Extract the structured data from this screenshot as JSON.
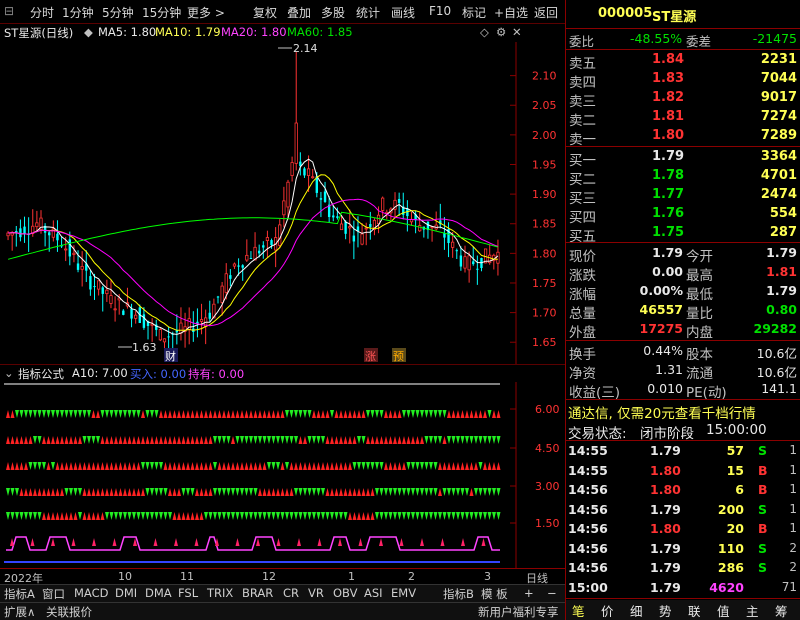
{
  "toolbar": {
    "items": [
      "分时",
      "1分钟",
      "5分钟",
      "15分钟",
      "更多 >",
      "复权",
      "叠加",
      "多股",
      "统计",
      "画线",
      "F10",
      "标记",
      "+自选",
      "返回"
    ]
  },
  "chart": {
    "title": "ST星源(日线)",
    "ma5": "MA5: 1.80",
    "ma10": "MA10: 1.79",
    "ma20": "MA20: 1.80",
    "ma60": "MA60: 1.85",
    "high_label": "2.14",
    "low_label": "1.63",
    "marker_cai": "财",
    "marker_zhang": "涨",
    "marker_yu": "预",
    "y_ticks": [
      "2.10",
      "2.05",
      "2.00",
      "1.95",
      "1.90",
      "1.85",
      "1.80",
      "1.75",
      "1.70",
      "1.65"
    ],
    "colors": {
      "up": "#ff3333",
      "down": "#00ffff",
      "ma5": "#ffffff",
      "ma10": "#ffff00",
      "ma20": "#ff00ff",
      "ma60": "#00ff00"
    }
  },
  "chart_data": {
    "type": "candlestick",
    "y_range": [
      1.62,
      2.15
    ],
    "high": 2.14,
    "low": 1.63,
    "ma": {
      "ma5": 1.8,
      "ma10": 1.79,
      "ma20": 1.8,
      "ma60": 1.85
    }
  },
  "indicator": {
    "name": "指标公式",
    "a10": "A10: 7.00",
    "buy": "买入: 0.00",
    "hold": "持有: 0.00",
    "y_ticks": [
      "6.00",
      "4.50",
      "3.00",
      "1.50"
    ]
  },
  "date_axis": {
    "labels": [
      "2022年",
      "10",
      "11",
      "12",
      "1",
      "2",
      "3"
    ],
    "period": "日线"
  },
  "tabs": {
    "items": [
      "指标A",
      "窗口",
      "MACD",
      "DMI",
      "DMA",
      "FSL",
      "TRIX",
      "BRAR",
      "CR",
      "VR",
      "OBV",
      "ASI",
      "EMV",
      "指标B",
      "模 板",
      "+",
      "−"
    ]
  },
  "statusbar": {
    "expand": "扩展∧",
    "related": "关联报价",
    "promo": "新用户福利专享"
  },
  "quote": {
    "code": "000005",
    "name": "ST星源",
    "wei_bi_label": "委比",
    "wei_bi": "-48.55%",
    "wei_cha_label": "委差",
    "wei_cha": "-21475",
    "asks": [
      {
        "label": "卖五",
        "price": "1.84",
        "vol": "2231"
      },
      {
        "label": "卖四",
        "price": "1.83",
        "vol": "7044"
      },
      {
        "label": "卖三",
        "price": "1.82",
        "vol": "9017"
      },
      {
        "label": "卖二",
        "price": "1.81",
        "vol": "7274"
      },
      {
        "label": "卖一",
        "price": "1.80",
        "vol": "7289"
      }
    ],
    "bids": [
      {
        "label": "买一",
        "price": "1.79",
        "vol": "3364"
      },
      {
        "label": "买二",
        "price": "1.78",
        "vol": "4701"
      },
      {
        "label": "买三",
        "price": "1.77",
        "vol": "2474"
      },
      {
        "label": "买四",
        "price": "1.76",
        "vol": "554"
      },
      {
        "label": "买五",
        "price": "1.75",
        "vol": "287"
      }
    ],
    "stats": [
      {
        "l1": "现价",
        "v1": "1.79",
        "l2": "今开",
        "v2": "1.79"
      },
      {
        "l1": "涨跌",
        "v1": "0.00",
        "l2": "最高",
        "v2": "1.81"
      },
      {
        "l1": "涨幅",
        "v1": "0.00%",
        "l2": "最低",
        "v2": "1.79"
      },
      {
        "l1": "总量",
        "v1": "46557",
        "l2": "量比",
        "v2": "0.80"
      },
      {
        "l1": "外盘",
        "v1": "17275",
        "l2": "内盘",
        "v2": "29282"
      }
    ],
    "fund": [
      {
        "l1": "换手",
        "v1": "0.44%",
        "l2": "股本",
        "v2": "10.6亿"
      },
      {
        "l1": "净资",
        "v1": "1.31",
        "l2": "流通",
        "v2": "10.6亿"
      },
      {
        "l1": "收益(三)",
        "v1": "0.010",
        "l2": "PE(动)",
        "v2": "141.1"
      }
    ],
    "promo": "通达信, 仅需20元查看千档行情",
    "trade_status_label": "交易状态:",
    "trade_status": "闭市阶段",
    "trade_time": "15:00:00",
    "ticks": [
      {
        "time": "14:55",
        "price": "1.79",
        "vol": "57",
        "bs": "S",
        "n": "1"
      },
      {
        "time": "14:55",
        "price": "1.80",
        "vol": "15",
        "bs": "B",
        "n": "1"
      },
      {
        "time": "14:56",
        "price": "1.80",
        "vol": "6",
        "bs": "B",
        "n": "1"
      },
      {
        "time": "14:56",
        "price": "1.79",
        "vol": "200",
        "bs": "S",
        "n": "1"
      },
      {
        "time": "14:56",
        "price": "1.80",
        "vol": "20",
        "bs": "B",
        "n": "1"
      },
      {
        "time": "14:56",
        "price": "1.79",
        "vol": "110",
        "bs": "S",
        "n": "2"
      },
      {
        "time": "14:56",
        "price": "1.79",
        "vol": "286",
        "bs": "S",
        "n": "2"
      },
      {
        "time": "15:00",
        "price": "1.79",
        "vol": "4620",
        "bs": "",
        "n": "71"
      }
    ],
    "bottom_tabs": [
      "笔",
      "价",
      "细",
      "势",
      "联",
      "值",
      "主",
      "筹"
    ]
  }
}
